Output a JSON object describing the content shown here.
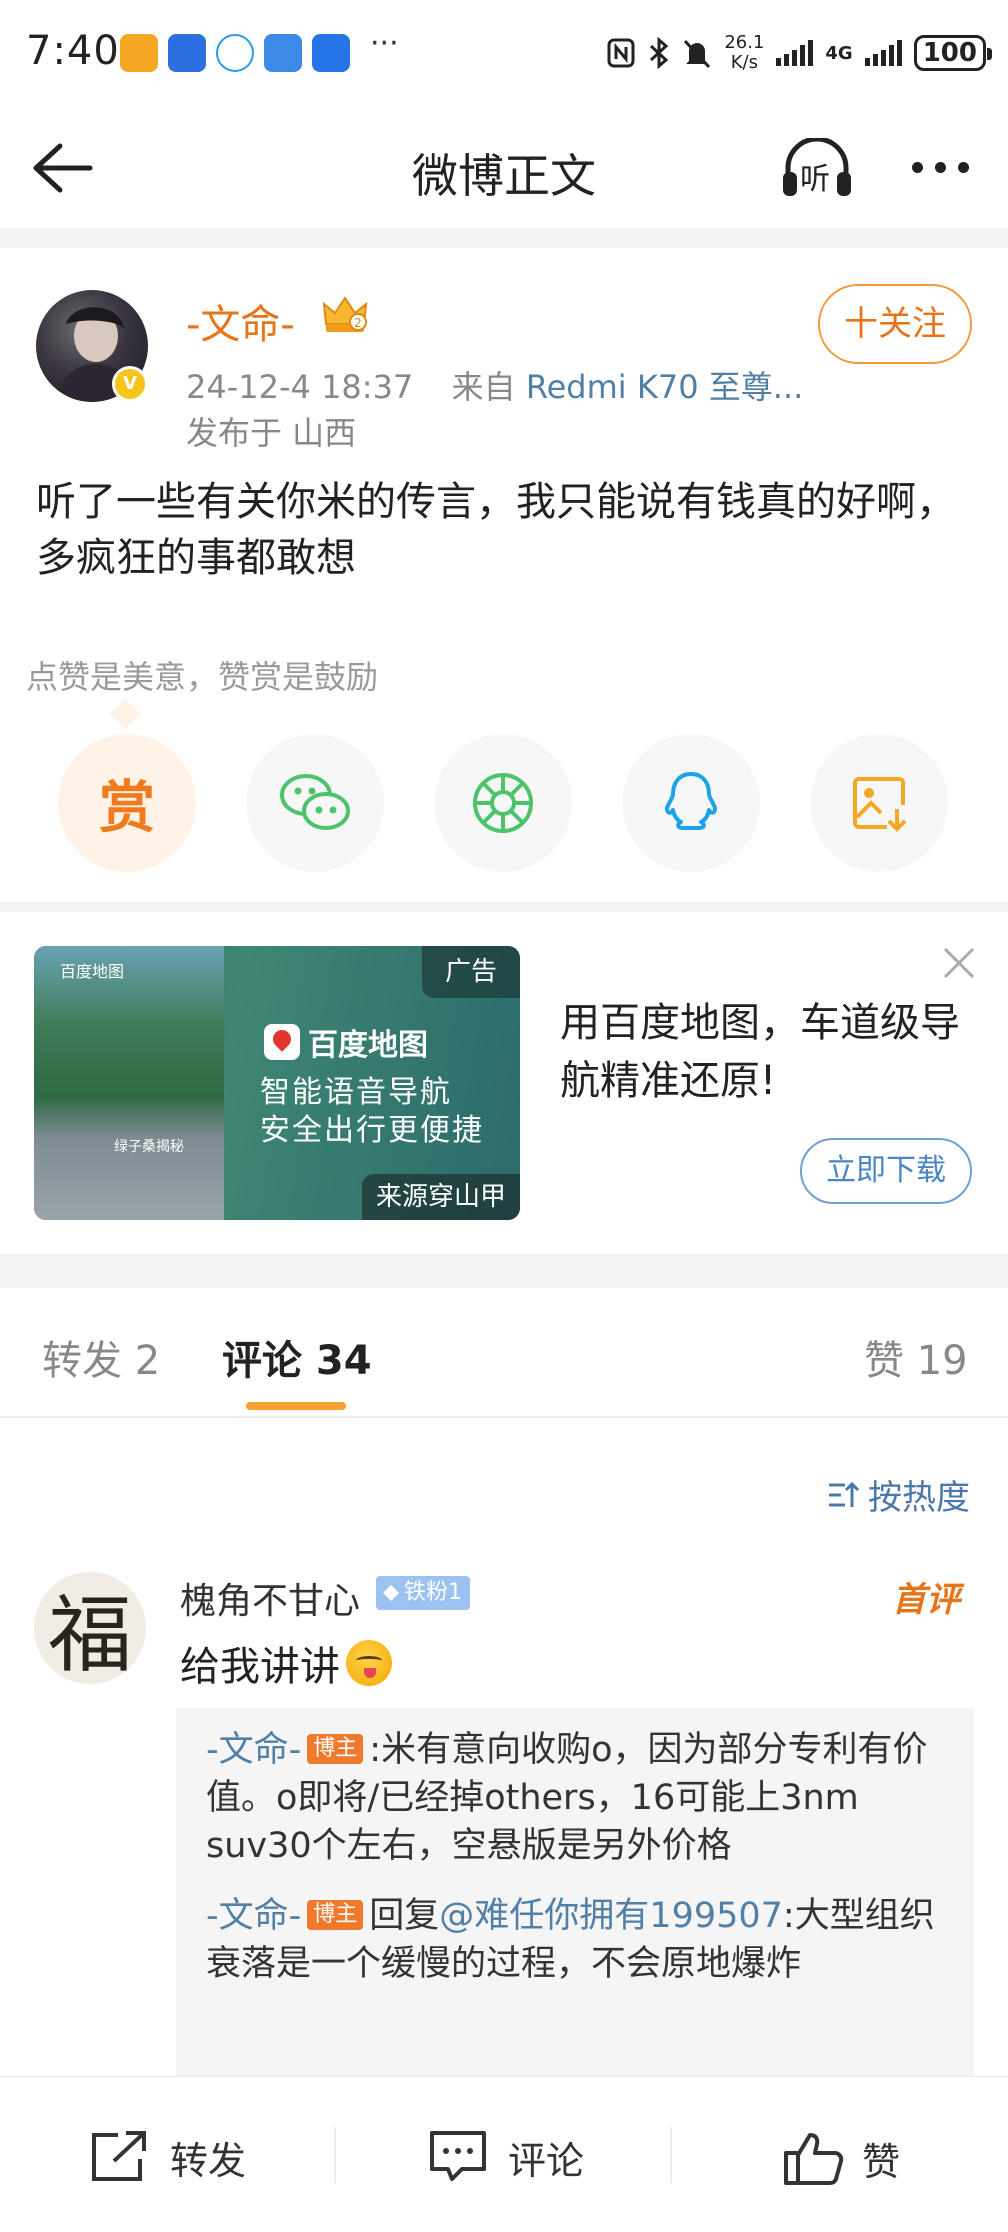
{
  "status_bar": {
    "time": "7:40",
    "more": "···",
    "net_speed_value": "26.1",
    "net_speed_unit": "K/s",
    "network": "4G",
    "battery": "100"
  },
  "nav": {
    "title": "微博正文",
    "listen_label": "听"
  },
  "post": {
    "author": "-文命-",
    "timestamp": "24-12-4 18:37",
    "source_prefix": "来自",
    "source_device": "Redmi K70 至尊...",
    "location": "发布于 山西",
    "follow_label": "十关注",
    "text": "听了一些有关你米的传言，我只能说有钱真的好啊，多疯狂的事都敢想",
    "verified_mark": "V"
  },
  "reward": {
    "tip": "点赞是美意，赞赏是鼓励",
    "reward_label": "赏"
  },
  "ad": {
    "tag": "广告",
    "brand": "百度地图",
    "slogan_line1": "智能语音导航",
    "slogan_line2": "安全出行更便捷",
    "source": "来源穿山甲",
    "mini_brand": "百度地图",
    "road_label": "绿子桑揭秘",
    "headline": "用百度地图，车道级导航精准还原!",
    "button_label": "立即下载"
  },
  "tabs": {
    "repost": "转发 2",
    "comments": "评论 34",
    "likes": "赞 19"
  },
  "sort": {
    "label": "按热度"
  },
  "comment": {
    "author": "槐角不甘心",
    "avatar_char": "福",
    "fan_badge": "铁粉1",
    "first_badge": "首评",
    "text": "给我讲讲",
    "replies": [
      {
        "name": "-文命-",
        "badge": "博主",
        "separator": ":",
        "text": "米有意向收购o，因为部分专利有价值。o即将/已经掉others，16可能上3nm suv30个左右，空悬版是另外价格"
      },
      {
        "name": "-文命-",
        "badge": "博主",
        "reply_prefix": "回复",
        "mention": "@难任你拥有199507",
        "separator": ":",
        "text": "大型组织衰落是一个缓慢的过程，不会原地爆炸"
      }
    ]
  },
  "bottom_bar": {
    "repost": "转发",
    "comment": "评论",
    "like": "赞"
  },
  "colors": {
    "accent_orange": "#e8741a",
    "link_blue": "#527fa5",
    "tab_underline": "#f7a032",
    "reward_bg": "#fff3e8"
  }
}
